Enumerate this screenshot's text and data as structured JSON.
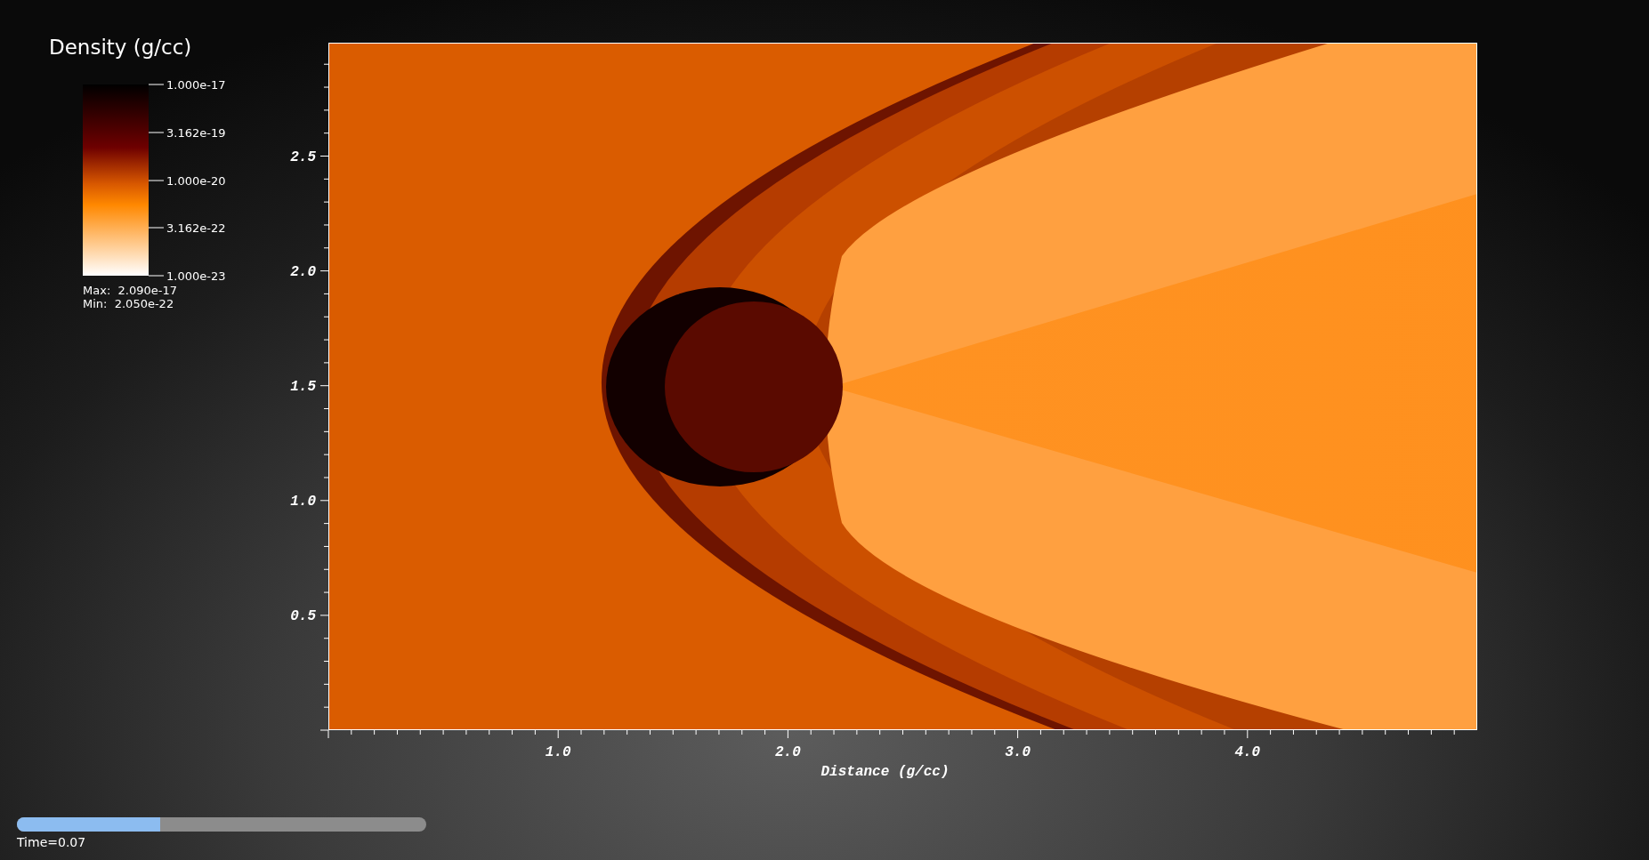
{
  "legend": {
    "title": "Density (g/cc)",
    "tick_labels": [
      "1.000e-17",
      "3.162e-19",
      "1.000e-20",
      "3.162e-22",
      "1.000e-23"
    ],
    "max": "Max:  2.090e-17",
    "min": "Min:  2.050e-22"
  },
  "plot": {
    "x_axis": {
      "title": "Distance (g/cc)",
      "tick_labels": [
        "1.0",
        "2.0",
        "3.0",
        "4.0"
      ]
    },
    "y_axis": {
      "tick_labels": [
        "2.5",
        "2.0",
        "1.5",
        "1.0",
        "0.5"
      ]
    }
  },
  "time_slider": {
    "level": 0.35,
    "label": "Time=0.07"
  }
}
